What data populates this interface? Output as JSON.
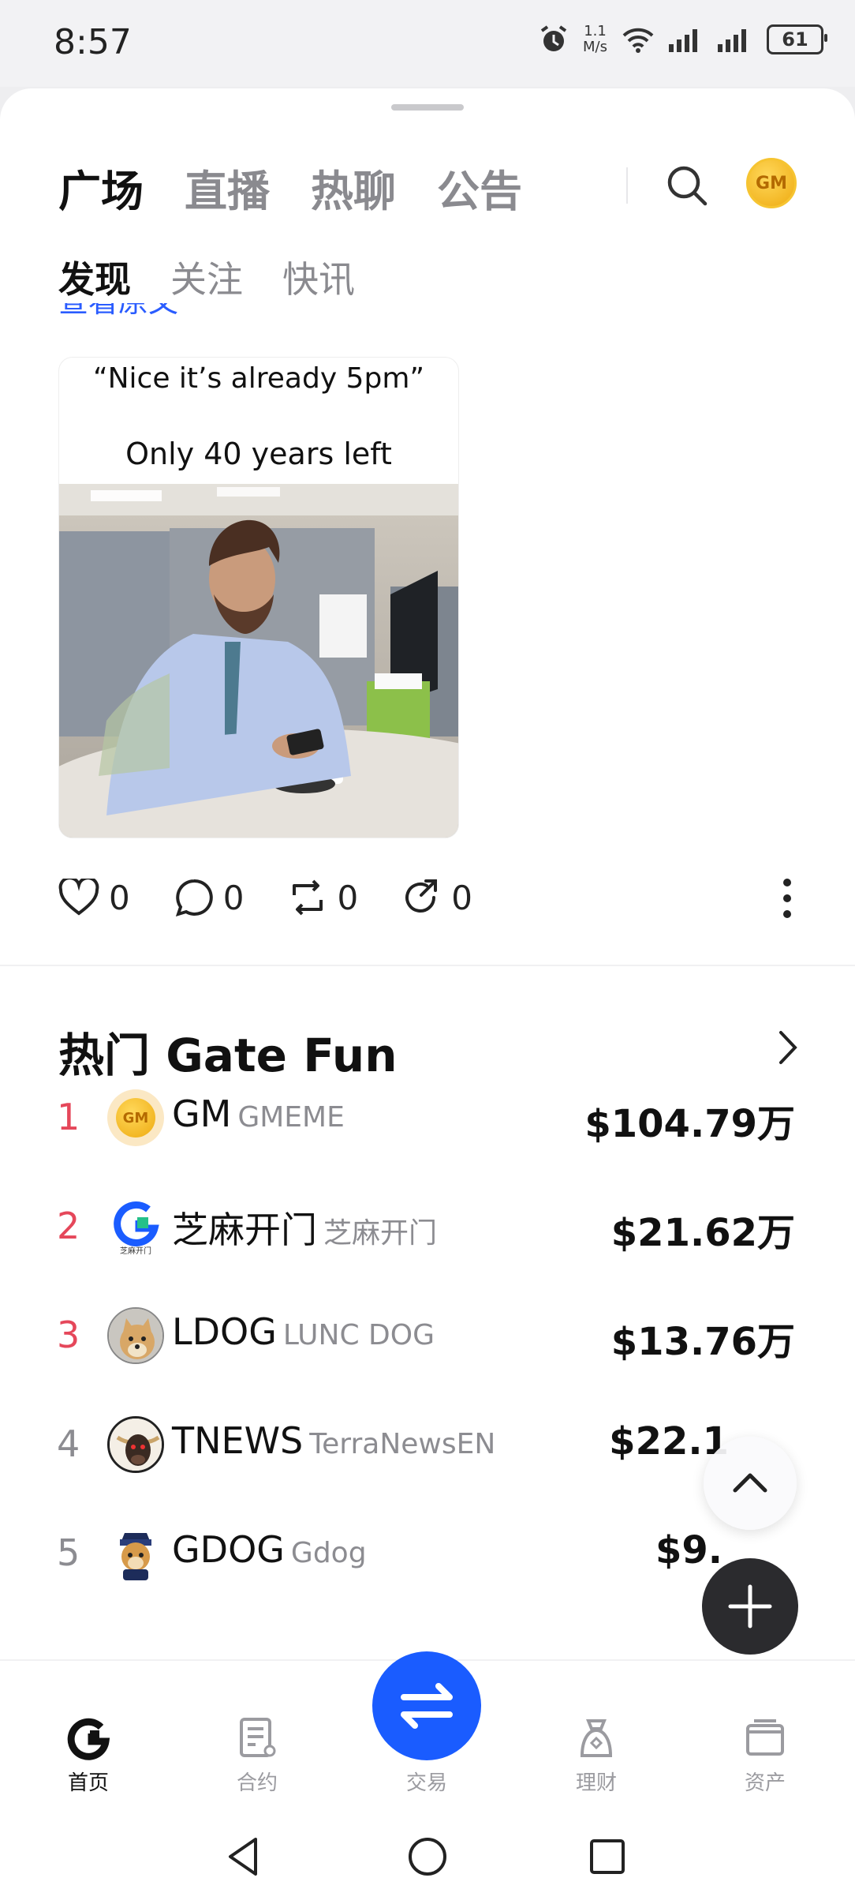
{
  "status_bar": {
    "time": "8:57",
    "net_speed_top": "1.1",
    "net_speed_bottom": "M/s",
    "battery": "61"
  },
  "tabs": {
    "main": [
      "广场",
      "直播",
      "热聊",
      "公告"
    ],
    "sub": [
      "发现",
      "关注",
      "快讯"
    ]
  },
  "header": {
    "avatar_text": "GM"
  },
  "clipped_text": "查看原文",
  "post": {
    "caption_top": "“Nice it’s already 5pm”",
    "caption_bottom": "Only 40 years left",
    "likes": "0",
    "comments": "0",
    "reposts": "0",
    "shares": "0"
  },
  "hot": {
    "title": "热门 Gate Fun",
    "items": [
      {
        "rank": "1",
        "name": "GM",
        "sub": "GMEME",
        "price": "$104.79万",
        "rank_color": "#e5475a"
      },
      {
        "rank": "2",
        "name": "芝麻开门",
        "sub": "芝麻开门",
        "price": "$21.62万",
        "rank_color": "#e5475a"
      },
      {
        "rank": "3",
        "name": "LDOG",
        "sub": "LUNC DOG",
        "price": "$13.76万",
        "rank_color": "#e5475a"
      },
      {
        "rank": "4",
        "name": "TNEWS",
        "sub": "TerraNewsEN",
        "price": "$22.1",
        "rank_color": "#8c8c91"
      },
      {
        "rank": "5",
        "name": "GDOG",
        "sub": "Gdog",
        "price": "$9.",
        "rank_color": "#8c8c91"
      }
    ]
  },
  "logo_texts": {
    "gm": "GM",
    "zhima": "芝麻开门"
  },
  "bottom_nav": {
    "home": "首页",
    "contract": "合约",
    "trade": "交易",
    "finance": "理财",
    "assets": "资产"
  },
  "colors": {
    "accent_blue": "#1a5cff",
    "rank_red": "#e5475a"
  }
}
